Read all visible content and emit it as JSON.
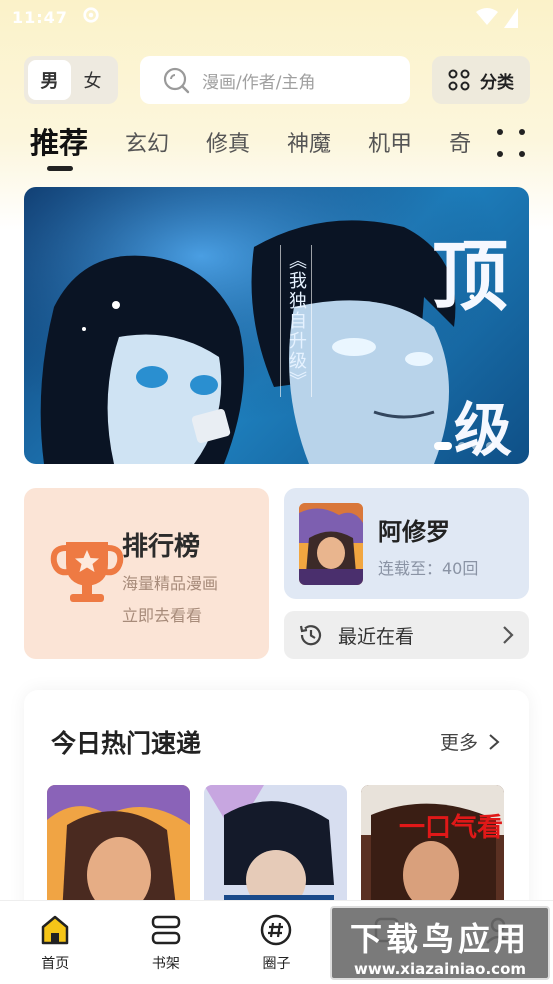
{
  "status_bar": {
    "time": "11:47"
  },
  "header": {
    "gender_options": [
      "男",
      "女"
    ],
    "gender_selected": "男",
    "search_placeholder": "漫画/作者/主角",
    "category_label": "分类"
  },
  "tabs": [
    "推荐",
    "玄幻",
    "修真",
    "神魔",
    "机甲",
    "奇"
  ],
  "banner": {
    "subtitle": "《我独自升级》",
    "headline_top": "顶",
    "headline_bottom": "级",
    "dot_count": 4,
    "active_dot": 0
  },
  "rank_card": {
    "title": "排行榜",
    "line1": "海量精品漫画",
    "line2": "立即去看看"
  },
  "continue_card": {
    "title": "阿修罗",
    "progress": "连载至：40回"
  },
  "recent": {
    "label": "最近在看"
  },
  "hot": {
    "title": "今日热门速递",
    "more": "更多",
    "thumb3_text": "一口气看"
  },
  "bottom_nav": [
    "首页",
    "书架",
    "圈子",
    "",
    ""
  ],
  "watermark": {
    "line1": "下载鸟应用",
    "line2": "www.xiazainiao.com"
  },
  "colors": {
    "accent_orange": "#ee7a43",
    "rank_bg": "#fbe4d6",
    "continue_bg": "#e0e8f4",
    "banner_blue": "#1b6aa6"
  }
}
